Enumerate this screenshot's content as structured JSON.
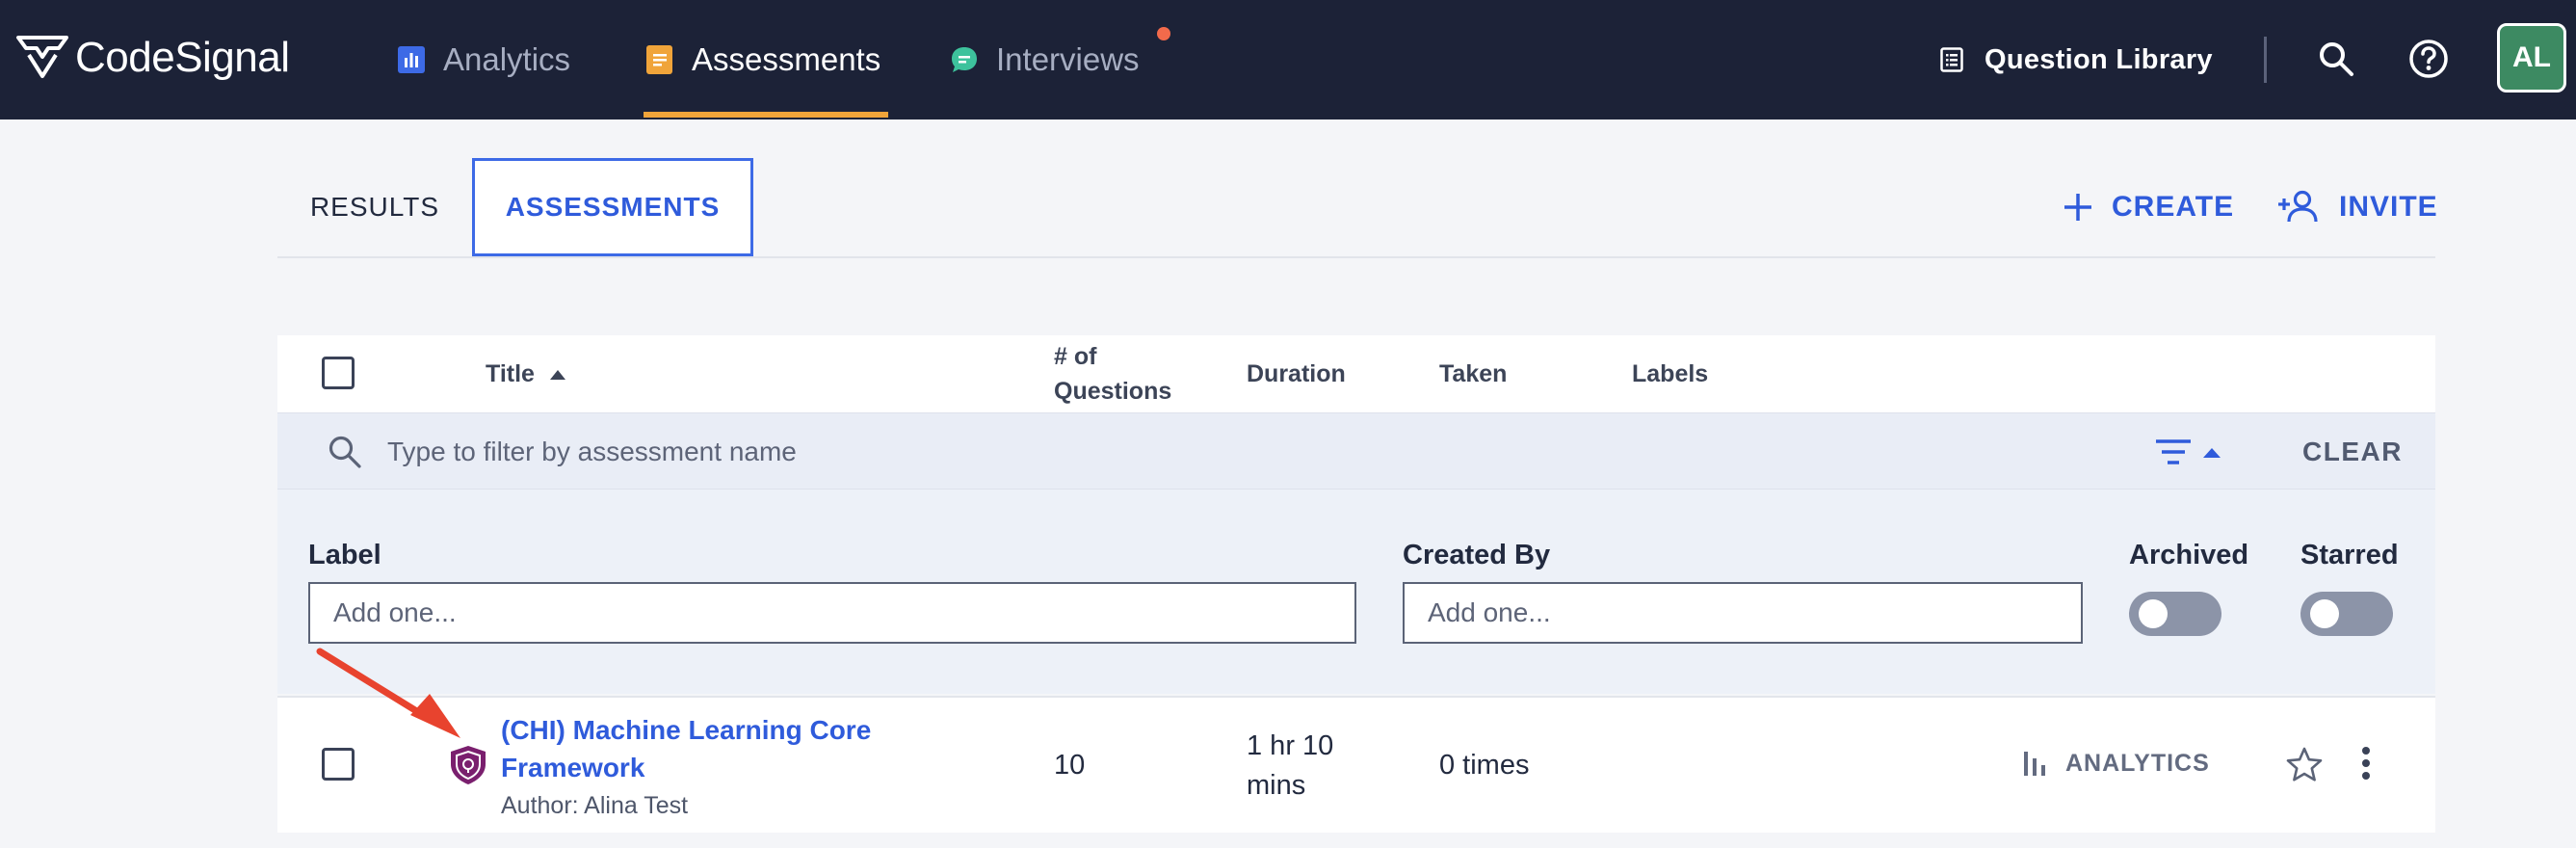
{
  "header": {
    "brand": "CodeSignal",
    "nav": [
      {
        "label": "Analytics",
        "icon": "bar-chart-icon",
        "active": false
      },
      {
        "label": "Assessments",
        "icon": "document-icon",
        "active": true
      },
      {
        "label": "Interviews",
        "icon": "chat-icon",
        "active": false,
        "notification": true
      }
    ],
    "question_library": "Question Library",
    "avatar_initials": "AL"
  },
  "tabs": [
    {
      "label": "RESULTS",
      "active": false
    },
    {
      "label": "ASSESSMENTS",
      "active": true
    }
  ],
  "actions": {
    "create": "CREATE",
    "invite": "INVITE"
  },
  "table": {
    "columns": {
      "title": "Title",
      "questions_line1": "# of",
      "questions_line2": "Questions",
      "duration": "Duration",
      "taken": "Taken",
      "labels": "Labels"
    },
    "filter": {
      "placeholder": "Type to filter by assessment name",
      "clear": "CLEAR"
    },
    "filters_panel": {
      "label": "Label",
      "label_placeholder": "Add one...",
      "created_by": "Created By",
      "created_by_placeholder": "Add one...",
      "archived": "Archived",
      "starred": "Starred"
    },
    "rows": [
      {
        "title_line1": "(CHI) Machine Learning Core",
        "title_line2": "Framework",
        "author": "Author: Alina Test",
        "questions": "10",
        "duration_line1": "1 hr 10",
        "duration_line2": "mins",
        "taken": "0 times",
        "analytics": "ANALYTICS"
      }
    ]
  },
  "colors": {
    "nav_bg": "#1c2237",
    "accent_blue": "#2f5bdb",
    "nav_active_underline": "#f0a43a",
    "notification_dot": "#f26a4b",
    "avatar_bg": "#3d8a62",
    "annotation_arrow": "#e8432e",
    "badge_purple": "#7a1f6e"
  }
}
